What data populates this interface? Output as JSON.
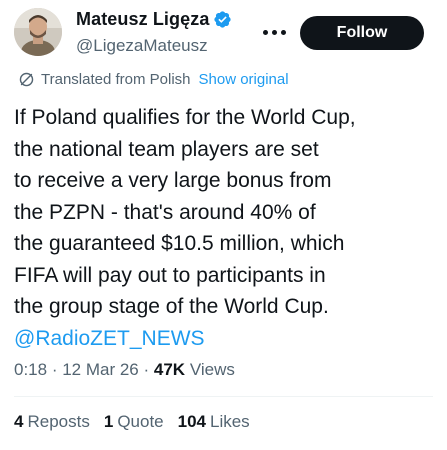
{
  "author": {
    "name": "Mateusz Ligęza",
    "handle": "@LigezaMateusz",
    "verified": true,
    "verified_color": "#1d9bf0"
  },
  "follow_label": "Follow",
  "translation": {
    "label": "Translated from Polish",
    "action": "Show original"
  },
  "text_lines": [
    "If Poland qualifies for the World Cup,",
    "the national team players are set",
    "to receive a very large bonus from",
    "the PZPN - that's around 40% of",
    "the guaranteed $10.5 million, which",
    "FIFA will pay out to participants in",
    "the group stage of the World Cup."
  ],
  "mention": "@RadioZET_NEWS",
  "meta": {
    "time": "0:18",
    "date": "12 Mar 26",
    "views_count": "47K",
    "views_label": "Views"
  },
  "stats": {
    "reposts_count": "4",
    "reposts_label": "Reposts",
    "quotes_count": "1",
    "quotes_label": "Quote",
    "likes_count": "104",
    "likes_label": "Likes"
  },
  "colors": {
    "text": "#0f1419",
    "secondary": "#536471",
    "link": "#1d9bf0",
    "follow_bg": "#0f1419"
  }
}
